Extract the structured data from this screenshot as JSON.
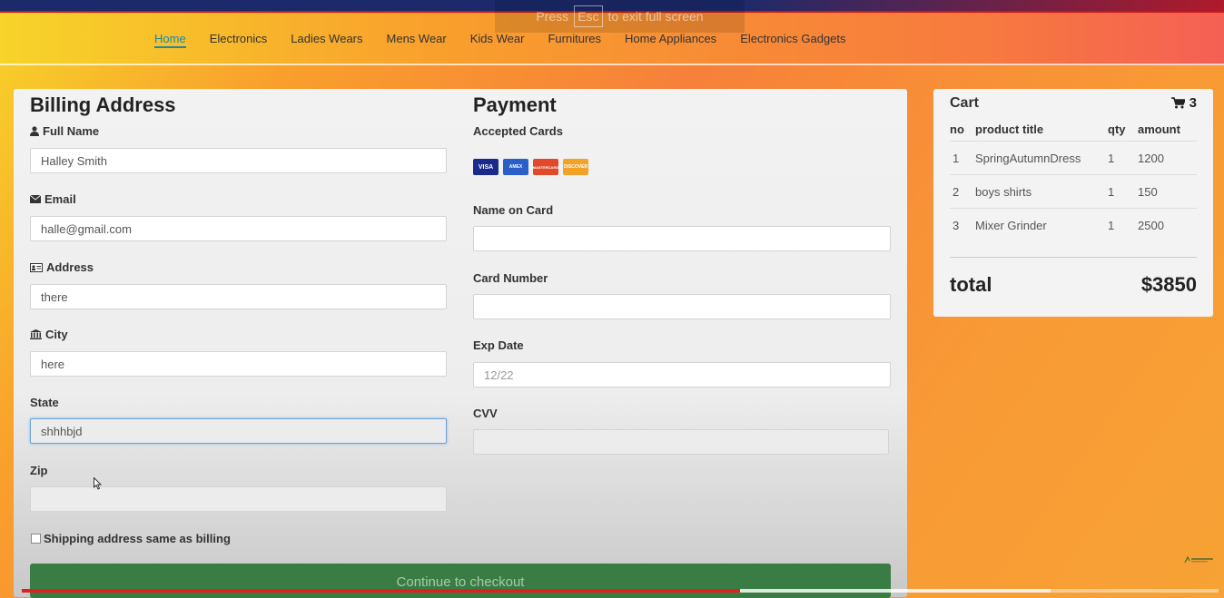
{
  "fullscreen_hint": {
    "press": "Press",
    "key": "Esc",
    "rest": "to exit full screen"
  },
  "nav": {
    "items": [
      "Home",
      "Electronics",
      "Ladies Wears",
      "Mens Wear",
      "Kids Wear",
      "Furnitures",
      "Home Appliances",
      "Electronics Gadgets"
    ],
    "active": "Home",
    "active_color": "#1a8aa8"
  },
  "billing": {
    "title": "Billing Address",
    "full_name_label": "Full Name",
    "full_name_value": "Halley Smith",
    "email_label": "Email",
    "email_value": "halle@gmail.com",
    "address_label": "Address",
    "address_value": "there",
    "city_label": "City",
    "city_value": "here",
    "state_label": "State",
    "state_value": "shhhbjd",
    "zip_label": "Zip",
    "zip_value": "",
    "same_address_label": "Shipping address same as billing"
  },
  "payment": {
    "title": "Payment",
    "accepted_cards_label": "Accepted Cards",
    "cards": [
      "VISA",
      "AMEX",
      "MASTERCARD",
      "DISCOVER"
    ],
    "name_on_card_label": "Name on Card",
    "name_on_card_value": "",
    "card_number_label": "Card Number",
    "card_number_value": "",
    "exp_date_label": "Exp Date",
    "exp_date_placeholder": "12/22",
    "cvv_label": "CVV",
    "cvv_value": ""
  },
  "checkout_button": "Continue to checkout",
  "checkout_color": "#3a7d44",
  "cart": {
    "title": "Cart",
    "count": "3",
    "columns": [
      "no",
      "product title",
      "qty",
      "amount"
    ],
    "rows": [
      {
        "no": "1",
        "title": "SpringAutumnDress",
        "qty": "1",
        "amount": "1200"
      },
      {
        "no": "2",
        "title": "boys shirts",
        "qty": "1",
        "amount": "150"
      },
      {
        "no": "3",
        "title": "Mixer Grinder",
        "qty": "1",
        "amount": "2500"
      }
    ],
    "total_label": "total",
    "total_value": "$3850"
  },
  "video": {
    "progress": 0.6,
    "buffered": 0.86
  },
  "icons": [
    "user-icon",
    "envelope-icon",
    "address-card-icon",
    "institution-icon",
    "cart-icon"
  ]
}
